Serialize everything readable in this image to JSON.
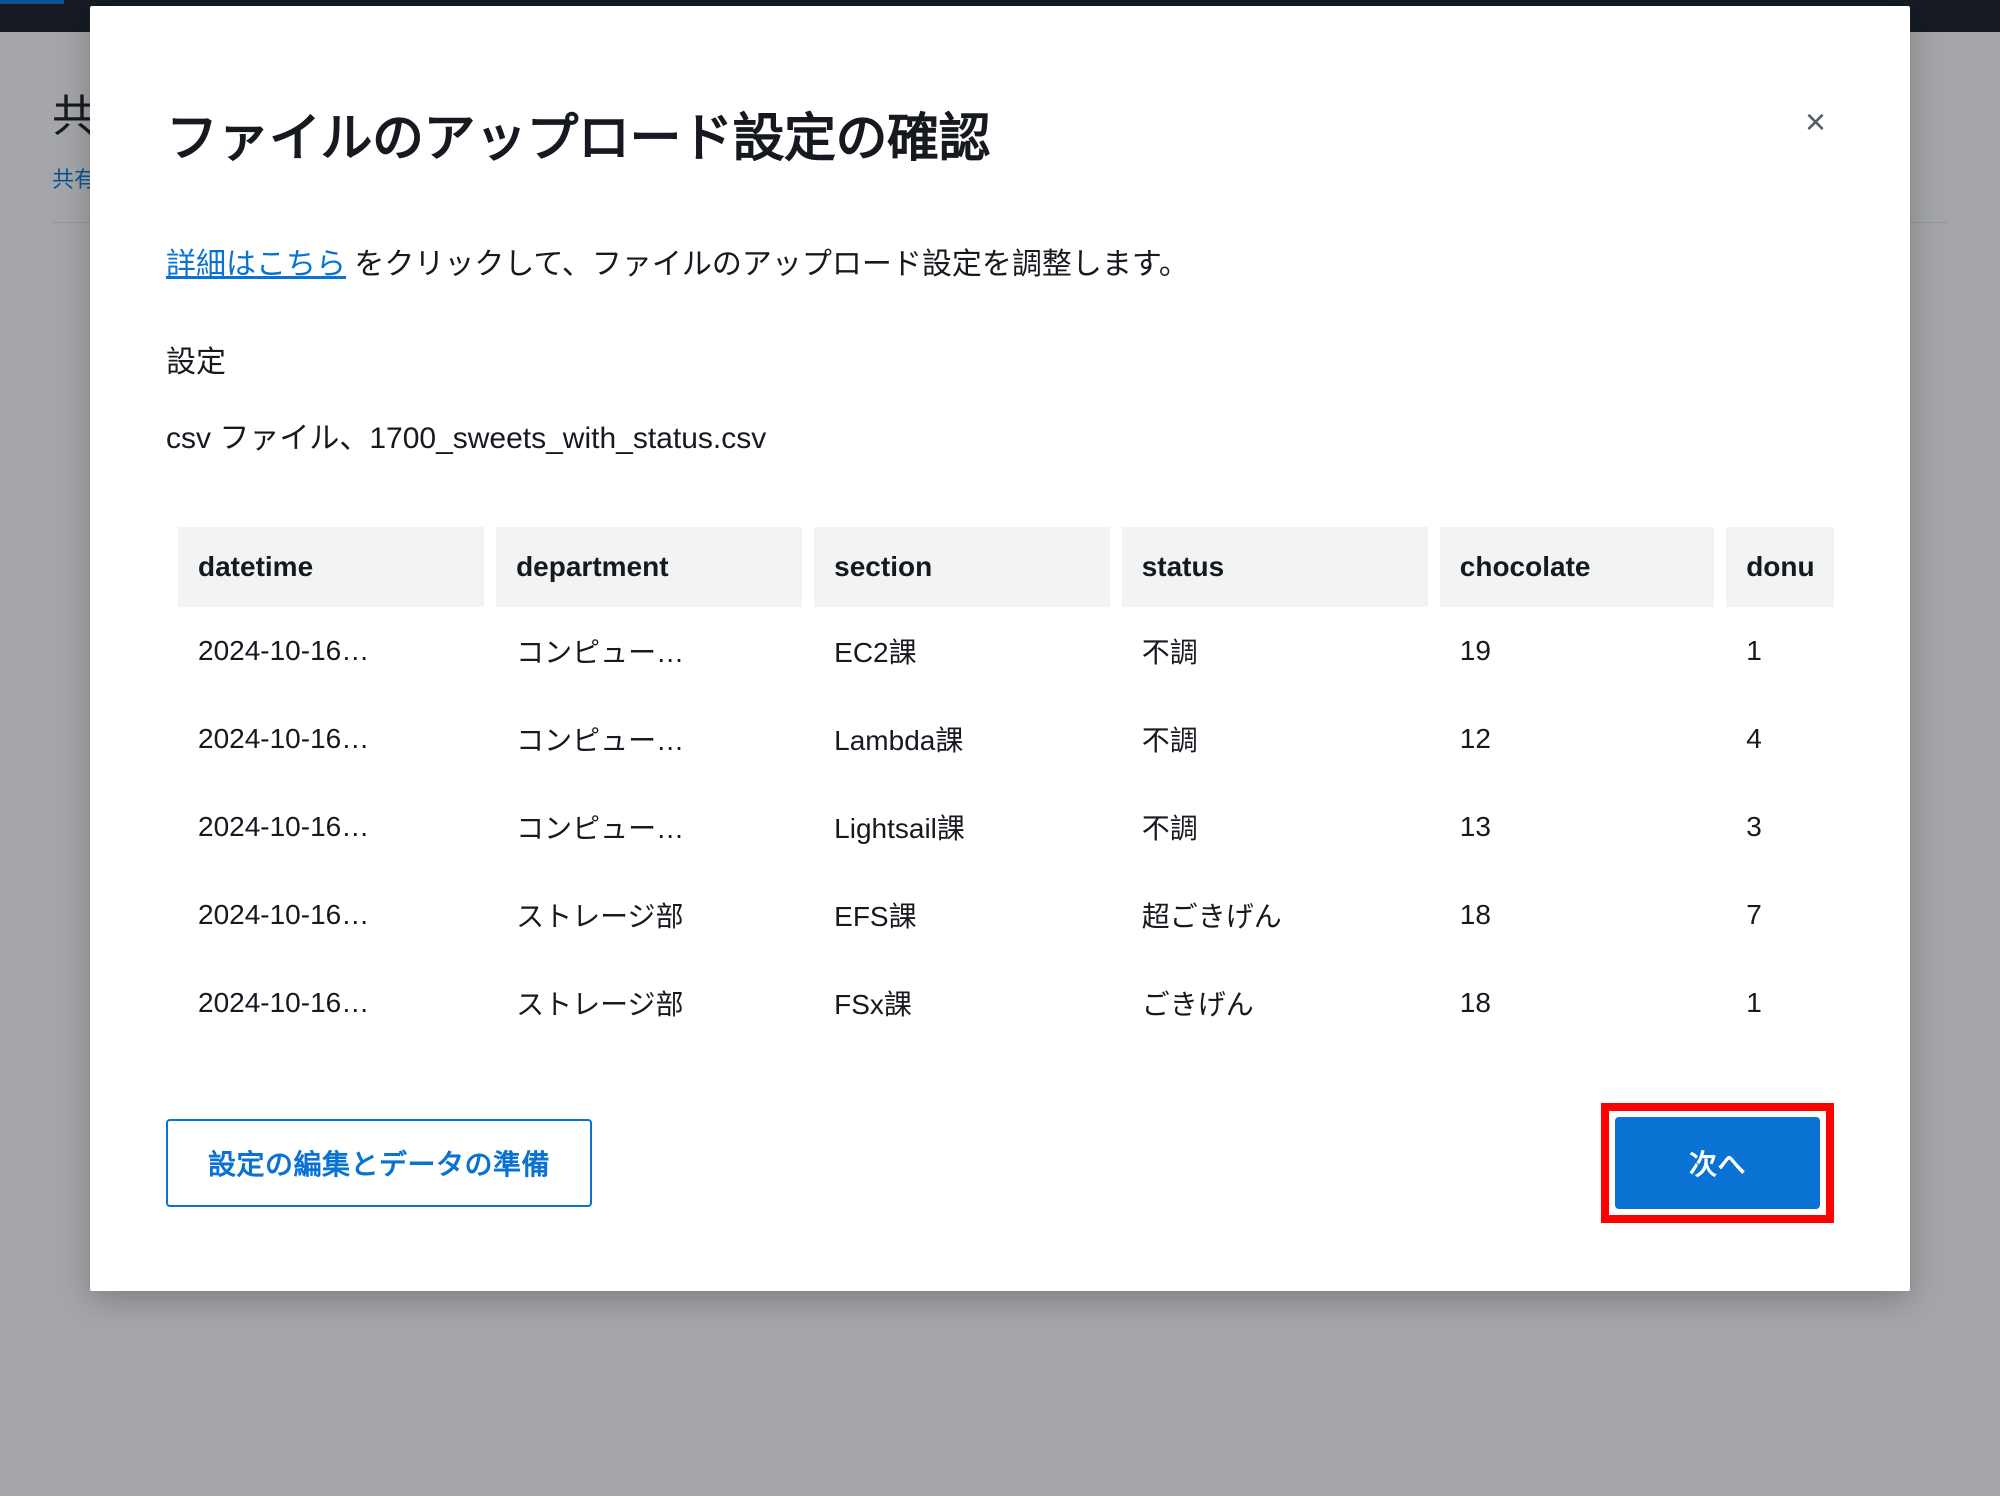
{
  "backdrop": {
    "title_partial": "共",
    "link_partial": "共有"
  },
  "modal": {
    "title": "ファイルのアップロード設定の確認",
    "close_label": "×",
    "info_link": "詳細はこちら",
    "info_rest": " をクリックして、ファイルのアップロード設定を調整します。",
    "settings_label": "設定",
    "file_line": "csv ファイル、1700_sweets_with_status.csv"
  },
  "table": {
    "headers": {
      "datetime": "datetime",
      "department": "department",
      "section": "section",
      "status": "status",
      "chocolate": "chocolate",
      "donu": "donu"
    },
    "rows": [
      {
        "datetime": "2024-10-16…",
        "department": "コンピュー…",
        "section": "EC2課",
        "status": "不調",
        "chocolate": "19",
        "donu": "1"
      },
      {
        "datetime": "2024-10-16…",
        "department": "コンピュー…",
        "section": "Lambda課",
        "status": "不調",
        "chocolate": "12",
        "donu": "4"
      },
      {
        "datetime": "2024-10-16…",
        "department": "コンピュー…",
        "section": "Lightsail課",
        "status": "不調",
        "chocolate": "13",
        "donu": "3"
      },
      {
        "datetime": "2024-10-16…",
        "department": "ストレージ部",
        "section": "EFS課",
        "status": "超ごきげん",
        "chocolate": "18",
        "donu": "7"
      },
      {
        "datetime": "2024-10-16…",
        "department": "ストレージ部",
        "section": "FSx課",
        "status": "ごきげん",
        "chocolate": "18",
        "donu": "1"
      }
    ]
  },
  "footer": {
    "edit_button": "設定の編集とデータの準備",
    "next_button": "次へ"
  }
}
